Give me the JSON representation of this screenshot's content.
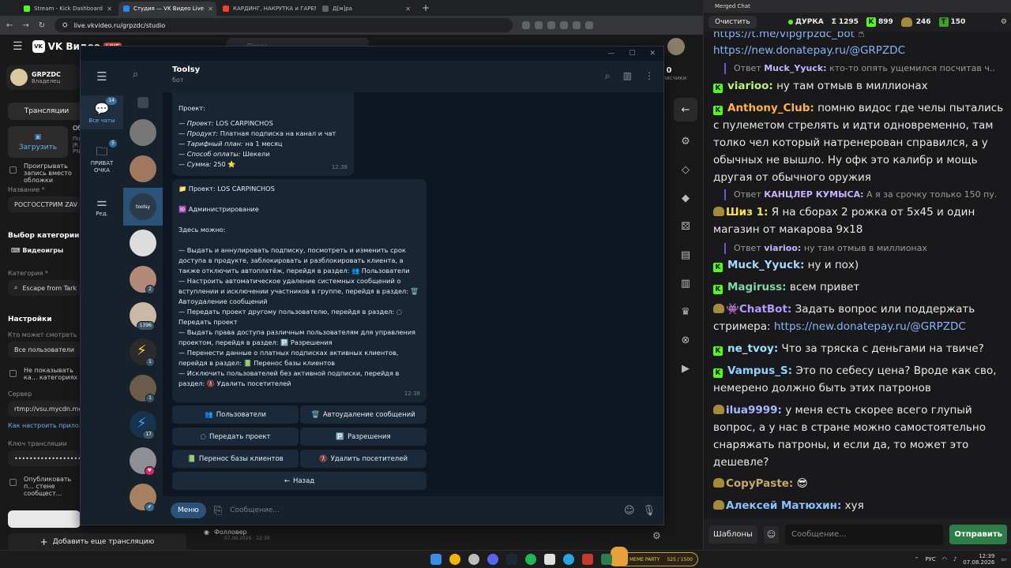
{
  "browser": {
    "tabs": [
      {
        "label": "Stream - Kick Dashboard",
        "color": "#53fc18"
      },
      {
        "label": "Студия — VK Видео Live",
        "color": "#2787f5"
      },
      {
        "label": "КАРДИНГ, НАКРУТКА и ГАРЕМ",
        "color": "#ff3b30"
      },
      {
        "label": "Д[м]ра",
        "color": "#5f6368"
      }
    ],
    "new_tab": "+",
    "url": "live.vkvideo.ru/grpzdc/studio"
  },
  "vk": {
    "logo": "VK Видео",
    "live_badge": "LIVE",
    "search_placeholder": "Поиск",
    "channel_name": "GRPZDC",
    "channel_role": "Владелец",
    "followers_count": "0",
    "followers_label": "подписчики",
    "tab_streams": "Трансляции",
    "upload_label": "Загрузить",
    "cover_label": "Об...",
    "cover_sub": "По... JR... PN...",
    "autoplay_label": "Проигрывать запись вместо обложки",
    "name_label": "Название *",
    "name_value": "РОСГОССТРИМ ZAV",
    "category_choice_title": "Выбор категории",
    "category_games": "Видеоигры",
    "category_label": "Категория *",
    "category_value": "Escape from Tark",
    "settings_title": "Настройки",
    "who_can_watch_label": "Кто может смотреть",
    "who_can_watch_value": "Все пользователи",
    "hide_category_label": "Не показывать ка... категориях",
    "server_label": "Сервер",
    "server_value": "rtmp://vsu.mycdn.me/",
    "how_to_setup": "Как настроить приложе...",
    "key_label": "Ключ трансляции",
    "key_value": "••••••••••••••••••••••••••••••••",
    "publish_label": "Опубликовать п... стене сообщест...",
    "add_stream": "Добавить еще трансляцию",
    "follower_event": "Фолловер",
    "follower_event_time": "07.08.2026 · 12:39"
  },
  "telegram": {
    "window_controls": [
      "—",
      "☐",
      "✕"
    ],
    "nav": [
      {
        "label": "Все чаты",
        "badge": "14"
      },
      {
        "label": "ПРИВАТ ОЧКА",
        "badge": "5"
      },
      {
        "label": "Ред.",
        "badge": ""
      }
    ],
    "chat_badges": [
      "2",
      "1396",
      "1",
      "1",
      "17"
    ],
    "selected_chat_avatar_text": "toolsy",
    "chat_title": "Toolsy",
    "chat_status": "бот",
    "msg1": {
      "heading": "Проект:",
      "lines": [
        {
          "k": "Проект:",
          "v": "LOS CARPINCHOS"
        },
        {
          "k": "Продукт:",
          "v": "Платная подписка на канал и чат"
        },
        {
          "k": "Тарифный план:",
          "v": "на 1 месяц"
        },
        {
          "k": "Способ оплаты:",
          "v": "Шекели"
        },
        {
          "k": "Сумма:",
          "v": "250 ⭐"
        }
      ],
      "time": "12:38"
    },
    "msg2": {
      "project_line": "📁 Проект: LOS CARPINCHOS",
      "admin_line": "🆔 Администрирование",
      "here_can": "Здесь можно:",
      "body": [
        "— Выдать и аннулировать подписку, посмотреть и изменить срок доступа в продукте, заблокировать и разблокировать клиента, а также отключить автоплатёж, перейдя в раздел: 👥 Пользователи",
        "— Настроить автоматическое удаление системных сообщений о вступлении и исключении участников в группе, перейдя в раздел: 🗑️ Автоудаление сообщений",
        "— Передать проект другому пользователю, перейдя в раздел: ◌ Передать проект",
        "— Выдать права доступа различным пользователям для управления проектом, перейдя в раздел: 🅿️ Разрешения",
        "— Перенести данные о платных подписках активных клиентов, перейдя в раздел: 📗 Перенос базы клиентов",
        "— Исключить пользователей без активной подписки, перейдя в раздел: 🚷 Удалить посетителей"
      ],
      "time": "12:38"
    },
    "keyboard": [
      {
        "icon": "👥",
        "label": "Пользователи"
      },
      {
        "icon": "🗑️",
        "label": "Автоудаление сообщений"
      },
      {
        "icon": "◌",
        "label": "Передать проект"
      },
      {
        "icon": "🅿️",
        "label": "Разрешения"
      },
      {
        "icon": "📗",
        "label": "Перенос базы клиентов"
      },
      {
        "icon": "🚷",
        "label": "Удалить посетителей"
      },
      {
        "icon": "←",
        "label": "Назад"
      }
    ],
    "menu_button": "Меню",
    "input_placeholder": "Сообщение..."
  },
  "chat": {
    "window_title": "Merged Chat",
    "clear_button": "Очистить",
    "channel": "ДУРКА",
    "stats": [
      {
        "icon": "Σ",
        "value": "1295"
      },
      {
        "icon": "K",
        "value": "899"
      },
      {
        "icon": "V",
        "value": "246"
      },
      {
        "icon": "T",
        "value": "150"
      }
    ],
    "messages": [
      {
        "text": "https://t.me/vipgrpzdc_bot"
      },
      {
        "text": "https://new.donatepay.ru/@GRPZDC"
      },
      {
        "reply_prefix": "Ответ",
        "reply_name": "Muck_Yyuck:",
        "reply_text": "кто-то опять ущемился посчитав ч..."
      },
      {
        "name": "viarioo:",
        "text": "ну там отмыв в миллионах"
      },
      {
        "name": "Anthony_Club:",
        "text": "помню видос где челы пытались с пулеметом стрелять и идти одновременно, там толко чел который натренерован справился, а у обычных не вышло. Ну офк это калибр и мощь другая от обычного оружия"
      },
      {
        "reply_prefix": "Ответ",
        "reply_name": "КАНЦЛЕР КУМЫСА:",
        "reply_text": "А я за срочку только 150 пу..."
      },
      {
        "name": "Шиз 1:",
        "text": "Я на сборах 2 рожка от 5х45 и один магазин от макарова 9х18"
      },
      {
        "reply_prefix": "Ответ",
        "reply_name": "viarioo:",
        "reply_text": "ну там отмыв в миллионах"
      },
      {
        "name": "Muck_Yyuck:",
        "text": "ну и пох)"
      },
      {
        "name": "Magiruss:",
        "text": "всем привет"
      },
      {
        "name": "ChatBot:",
        "text": "Задать вопрос или поддержать стримера:",
        "link": "https://new.donatepay.ru/@GRPZDC"
      },
      {
        "name": "ne_tvoy:",
        "text": "Что за тряска с деньгами на твиче?"
      },
      {
        "name": "Vampus_S:",
        "text": "Это по себесу цена? Вроде как сво, немерено должно быть этих патронов"
      },
      {
        "name": "ilua9999:",
        "text": "у меня есть скорее всего глупый вопрос, а у нас в стране можно самостоятельно снаряжать патроны, и если да, то может это дешевле?"
      },
      {
        "name": "CopyPaste:",
        "text": ""
      },
      {
        "name": "Алексей Матюхин:",
        "text": "хуя"
      }
    ],
    "templates_button": "Шаблоны",
    "input_placeholder": "Сообщение...",
    "send_button": "Отправить",
    "colors": {
      "viarioo": "#b9f27c",
      "Anthony_Club": "#ffb347",
      "Shiz": "#f9e04b",
      "Muck": "#a7d8ff",
      "Magiruss": "#7fd6a6",
      "ChatBot": "#b49cff",
      "ne_tvoy": "#9be0ff",
      "Vampus": "#8fd3ff",
      "ilua": "#a6b8ff",
      "CopyPaste": "#c8a86b",
      "Alexey": "#8ac2ff"
    }
  },
  "taskbar": {
    "meme_title": "MEME PARTY",
    "meme_count": "525 / 1500",
    "lang": "РУС",
    "time": "12:39",
    "date": "07.08.2026"
  }
}
